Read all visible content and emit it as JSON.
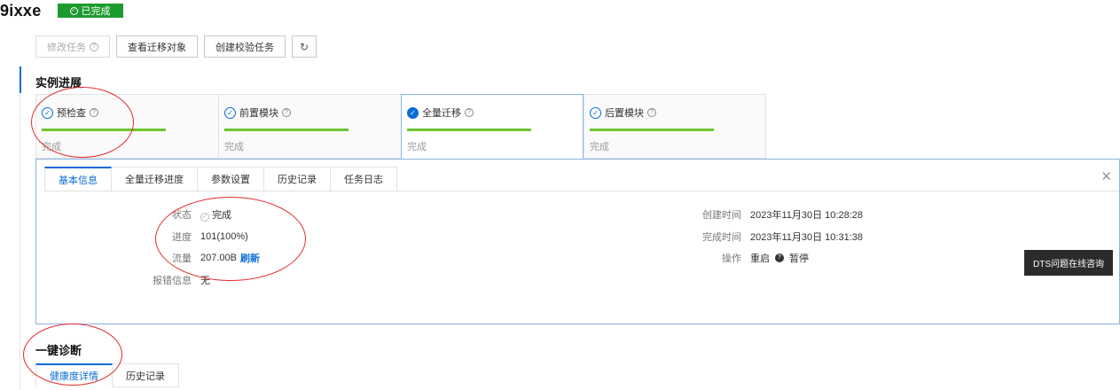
{
  "header": {
    "title": "9ixxe",
    "status": "已完成"
  },
  "toolbar": {
    "modify_task": "修改任务",
    "view_objects": "查看迁移对象",
    "create_verify": "创建校验任务"
  },
  "instance_progress": {
    "title": "实例进展",
    "steps": [
      {
        "label": "预检查",
        "status": "完成",
        "progress": 1.0
      },
      {
        "label": "前置模块",
        "status": "完成",
        "progress": 1.0
      },
      {
        "label": "全量迁移",
        "status": "完成",
        "progress": 1.0
      },
      {
        "label": "后置模块",
        "status": "完成",
        "progress": 1.0
      }
    ]
  },
  "detail_tabs": [
    "基本信息",
    "全量迁移进度",
    "参数设置",
    "历史记录",
    "任务日志"
  ],
  "basic_info": {
    "status_label": "状态",
    "status_value": "完成",
    "progress_label": "进度",
    "progress_value": "101(100%)",
    "traffic_label": "流量",
    "traffic_value": "207.00B",
    "refresh": "刷新",
    "error_label": "报错信息",
    "error_value": "无",
    "created_label": "创建时间",
    "created_value": "2023年11月30日 10:28:28",
    "finished_label": "完成时间",
    "finished_value": "2023年11月30日 10:31:38",
    "action_label": "操作",
    "action_restart": "重启",
    "action_pause": "暂停"
  },
  "tooltip": "DTS问题在线咨询",
  "diagnosis": {
    "title": "一键诊断",
    "tabs": [
      "健康度详情",
      "历史记录"
    ]
  }
}
